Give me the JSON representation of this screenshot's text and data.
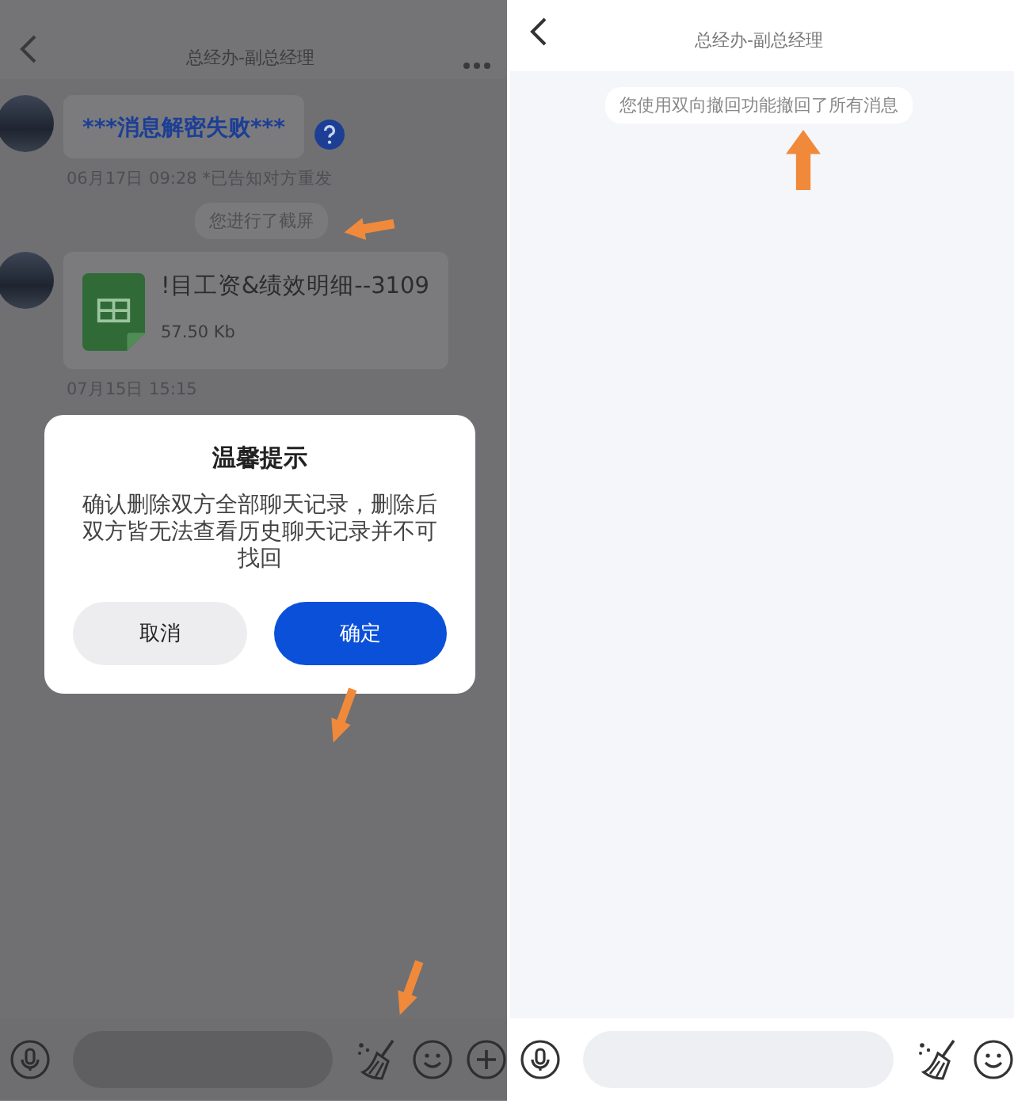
{
  "screens": [
    {
      "dimmed": true,
      "header": {
        "title": "总经办-副总经理"
      },
      "messages": [
        {
          "kind": "text",
          "text": "***消息解密失败***",
          "meta": "06月17日 09:28 *已告知对方重发"
        },
        {
          "kind": "notice",
          "text": "您进行了截屏"
        },
        {
          "kind": "file",
          "file_name": "!目工资&绩效明细--3109",
          "file_size": "57.50 Kb",
          "meta": "07月15日 15:15"
        }
      ],
      "dialog": {
        "title": "温馨提示",
        "body": "确认删除双方全部聊天记录，删除后双方皆无法查看历史聊天记录并不可找回",
        "buttons": [
          {
            "label": "取消",
            "primary": false
          },
          {
            "label": "确定",
            "primary": true
          }
        ]
      },
      "toolbar": {
        "plus": true
      }
    },
    {
      "dimmed": false,
      "header": {
        "title": "总经办-副总经理"
      },
      "messages": [
        {
          "kind": "notice",
          "text": "您使用双向撤回功能撤回了所有消息"
        }
      ],
      "toolbar": {
        "plus": false
      }
    }
  ]
}
